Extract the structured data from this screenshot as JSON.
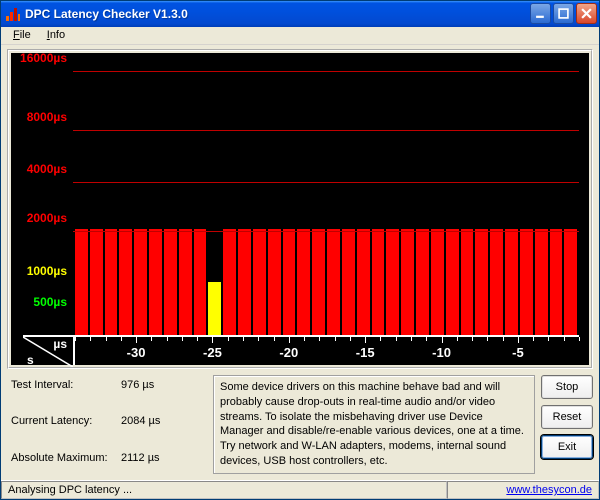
{
  "window": {
    "title": "DPC Latency Checker V1.3.0"
  },
  "menu": {
    "file": "File",
    "info": "Info"
  },
  "chart_data": {
    "type": "bar",
    "title": "",
    "xlabel": "s",
    "ylabel": "µs",
    "ylim": [
      0,
      16000
    ],
    "y_ticks": [
      {
        "v": 500,
        "label": "500µs",
        "class": "green"
      },
      {
        "v": 1000,
        "label": "1000µs",
        "class": "yellow"
      },
      {
        "v": 2000,
        "label": "2000µs",
        "class": "red",
        "line": true
      },
      {
        "v": 4000,
        "label": "4000µs",
        "class": "red",
        "line": true
      },
      {
        "v": 8000,
        "label": "8000µs",
        "class": "red",
        "line": true
      },
      {
        "v": 16000,
        "label": "16000µs",
        "class": "red",
        "line": true
      }
    ],
    "x_ticks": [
      -30,
      -25,
      -20,
      -15,
      -10,
      -5
    ],
    "categories": [
      -34,
      -33,
      -32,
      -31,
      -30,
      -29,
      -28,
      -27,
      -26,
      -25,
      -24,
      -23,
      -22,
      -21,
      -20,
      -19,
      -18,
      -17,
      -16,
      -15,
      -14,
      -13,
      -12,
      -11,
      -10,
      -9,
      -8,
      -7,
      -6,
      -5,
      -4,
      -3,
      -2,
      -1
    ],
    "values": [
      2100,
      2100,
      2110,
      2090,
      2100,
      2100,
      2110,
      2100,
      2090,
      1050,
      2100,
      2110,
      2100,
      2100,
      2100,
      2090,
      2100,
      2100,
      2110,
      2100,
      2100,
      2100,
      2090,
      2100,
      2100,
      2110,
      2100,
      2090,
      2100,
      2100,
      2100,
      2100,
      2110,
      2100
    ],
    "corner": {
      "top": "µs",
      "bottom": "s"
    }
  },
  "thresholds": {
    "warn": 2000
  },
  "stats": {
    "interval_label": "Test Interval:",
    "interval_value": "976 µs",
    "current_label": "Current Latency:",
    "current_value": "2084 µs",
    "max_label": "Absolute Maximum:",
    "max_value": "2112 µs"
  },
  "message": "Some device drivers on this machine behave bad and will probably cause drop-outs in real-time audio and/or video streams. To isolate the misbehaving driver use Device Manager and disable/re-enable various devices, one at a time. Try network and W-LAN adapters, modems, internal sound devices, USB host controllers, etc.",
  "buttons": {
    "stop": "Stop",
    "reset": "Reset",
    "exit": "Exit"
  },
  "status": {
    "text": "Analysing DPC latency ...",
    "link": "www.thesycon.de"
  }
}
